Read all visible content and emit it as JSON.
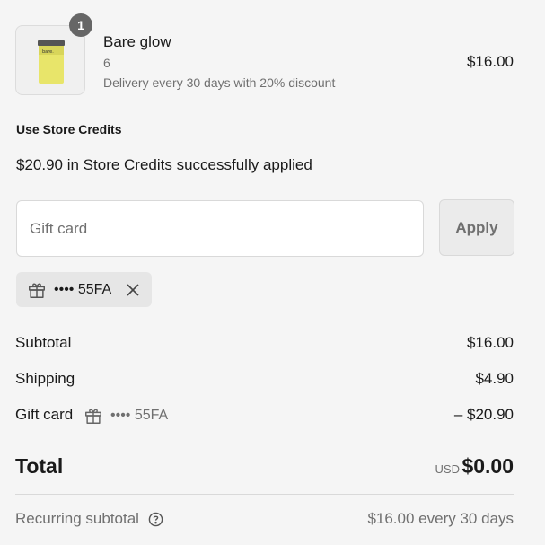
{
  "product": {
    "quantity_badge": "1",
    "title": "Bare glow",
    "variant": "6",
    "plan": "Delivery every 30 days with 20% discount",
    "price": "$16.00",
    "image_brand": "bare."
  },
  "store_credits": {
    "heading": "Use Store Credits",
    "message": "$20.90 in Store Credits successfully applied"
  },
  "gift_card": {
    "placeholder": "Gift card",
    "value": "",
    "apply_label": "Apply",
    "applied_code": "•••• 55FA"
  },
  "summary": {
    "subtotal_label": "Subtotal",
    "subtotal_value": "$16.00",
    "shipping_label": "Shipping",
    "shipping_value": "$4.90",
    "gift_card_label": "Gift card",
    "gift_card_code": "•••• 55FA",
    "gift_card_value": "– $20.90",
    "total_label": "Total",
    "currency": "USD",
    "total_value": "$0.00",
    "recurring_label": "Recurring subtotal",
    "recurring_value": "$16.00 every 30 days"
  },
  "icons": {
    "gift": "gift-icon",
    "close": "close-icon",
    "help": "help-circle-icon"
  },
  "colors": {
    "background": "#f5f5f5",
    "muted_text": "#707070",
    "badge": "#666666",
    "product_can": "#e8e56a"
  }
}
